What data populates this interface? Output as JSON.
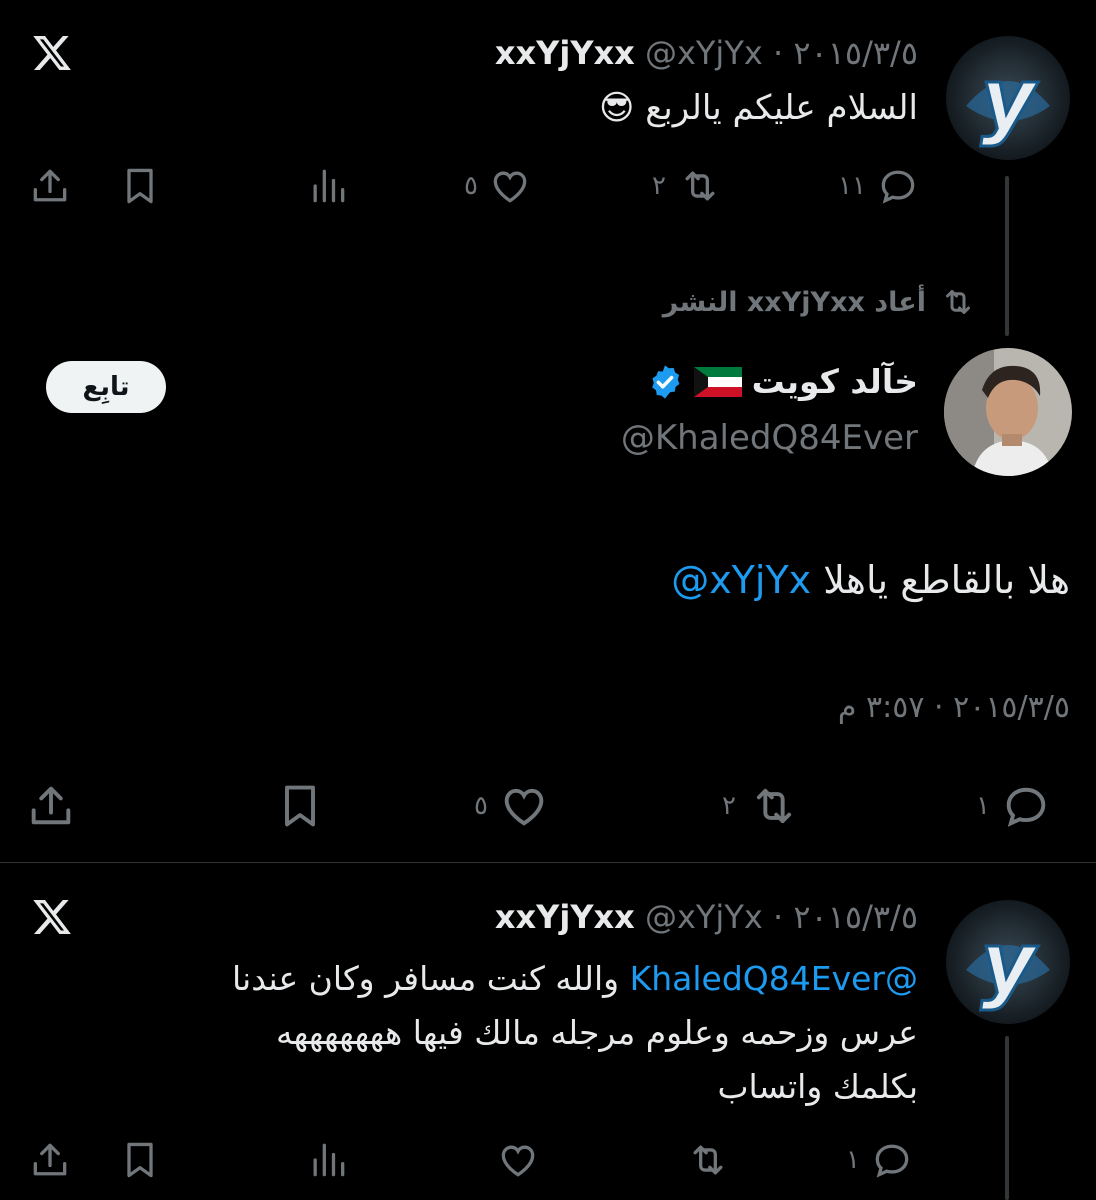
{
  "tweet1": {
    "display_name": "xxYjYxx",
    "handle": "@xYjYx",
    "separator": "·",
    "date": "٢٠١٥/٣/٥",
    "text": "السلام عليكم يالربع 😎",
    "reply_count": "١١",
    "retweet_count": "٢",
    "like_count": "٥"
  },
  "retweet_banner": {
    "text": "أعاد xxYjYxx النشر"
  },
  "tweet2": {
    "display_name": "خآلد كويت",
    "flag": "🇰🇼",
    "handle": "@KhaledQ84Ever",
    "follow_label": "تابِع",
    "mention": "@xYjYx",
    "text": "هلا بالقاطع ياهلا",
    "timestamp": "٢٠١٥/٣/٥ · ٣:٥٧ م",
    "reply_count": "١",
    "retweet_count": "٢",
    "like_count": "٥"
  },
  "tweet3": {
    "display_name": "xxYjYxx",
    "handle": "@xYjYx",
    "separator": "·",
    "date": "٢٠١٥/٣/٥",
    "mention": "@KhaledQ84Ever",
    "text_line1": "والله كنت مسافر وكان عندنا",
    "text_line2": "عرس وزحمه وعلوم مرجله مالك فيها هههههههه",
    "text_line3": "بكلمك واتساب",
    "reply_count": "١"
  },
  "colors": {
    "background": "#000000",
    "accent": "#1d9bf0",
    "muted": "#71767b",
    "verified": "#1d9bf0"
  },
  "icons": [
    "x-logo-icon",
    "reply-icon",
    "retweet-icon",
    "like-icon",
    "views-icon",
    "bookmark-icon",
    "share-icon",
    "verified-badge-icon",
    "kuwait-flag-icon"
  ]
}
